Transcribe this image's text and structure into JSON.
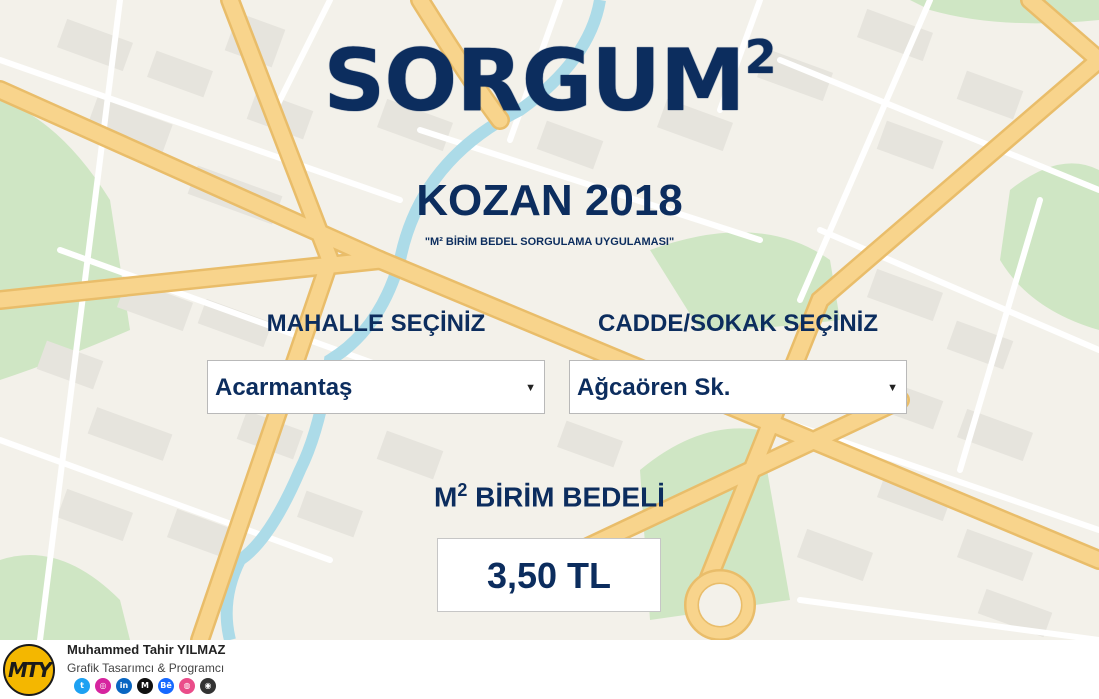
{
  "header": {
    "logo_text": "SORGUM",
    "logo_sup": "2",
    "city_title": "KOZAN 2018",
    "tagline": "\"M² BİRİM BEDEL SORGULAMA UYGULAMASI\""
  },
  "form": {
    "neighborhood_label": "MAHALLE SEÇİNİZ",
    "neighborhood_value": "Acarmantaş",
    "street_label": "CADDE/SOKAK SEÇİNİZ",
    "street_value": "Ağcaören Sk."
  },
  "result": {
    "title_prefix": "M",
    "title_sup": "2",
    "title_rest": " BİRİM BEDELİ",
    "value": "3,50 TL"
  },
  "footer": {
    "avatar_initials": "MTY",
    "author_name": "Muhammed Tahir YILMAZ",
    "author_role": "Grafik Tasarımcı & Programcı",
    "socials": [
      {
        "name": "twitter-icon",
        "glyph": "t",
        "color": "#1da1f2"
      },
      {
        "name": "instagram-icon",
        "glyph": "◎",
        "color": "#d6249f"
      },
      {
        "name": "linkedin-icon",
        "glyph": "in",
        "color": "#0a66c2"
      },
      {
        "name": "medium-icon",
        "glyph": "M",
        "color": "#111111"
      },
      {
        "name": "behance-icon",
        "glyph": "Bē",
        "color": "#1769ff"
      },
      {
        "name": "dribbble-icon",
        "glyph": "◍",
        "color": "#ea4c89"
      },
      {
        "name": "github-icon",
        "glyph": "◉",
        "color": "#333333"
      }
    ]
  },
  "colors": {
    "primary_text": "#0c2d5e",
    "map_background": "#f3f1ea",
    "road": "#f8d48c",
    "road_edge": "#e9bd6a",
    "park": "#cfe6c4",
    "river": "#acdbe8",
    "building": "#e6e4dd"
  }
}
